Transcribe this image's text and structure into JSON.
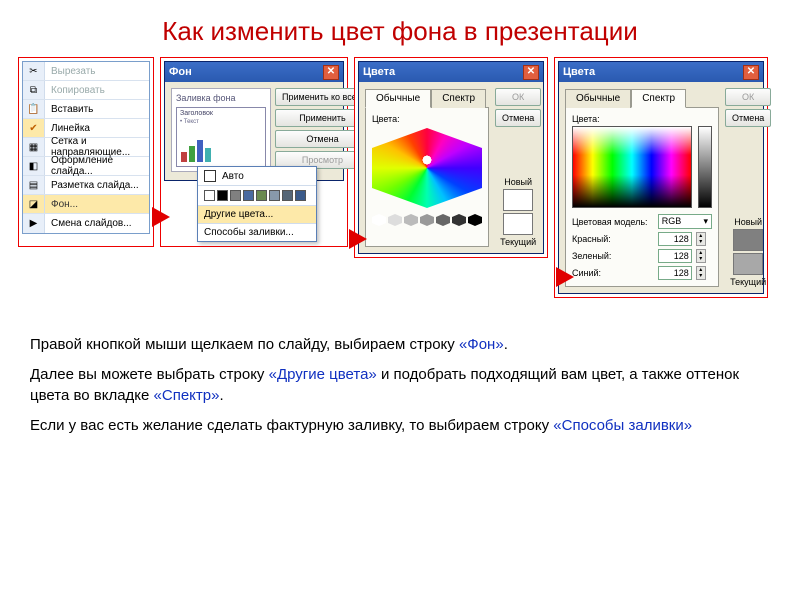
{
  "title": "Как изменить цвет фона в презентации",
  "context_menu": {
    "items": [
      {
        "label": "Вырезать",
        "dim": true,
        "icon": "cut"
      },
      {
        "label": "Копировать",
        "dim": true,
        "icon": "copy"
      },
      {
        "label": "Вставить",
        "dim": false,
        "icon": "paste"
      },
      {
        "label": "Линейка",
        "dim": false,
        "icon": "ruler",
        "checked": true
      },
      {
        "label": "Сетка и направляющие...",
        "dim": false,
        "icon": "grid"
      },
      {
        "label": "Оформление слайда...",
        "dim": false,
        "icon": "design"
      },
      {
        "label": "Разметка слайда...",
        "dim": false,
        "icon": "layout"
      },
      {
        "label": "Фон...",
        "dim": false,
        "icon": "fill",
        "selected": true
      },
      {
        "label": "Смена слайдов...",
        "dim": false,
        "icon": "transition"
      }
    ]
  },
  "bg_dialog": {
    "title": "Фон",
    "group_label": "Заливка фона",
    "thumb_title": "Заголовок",
    "thumb_body": "• Текст",
    "buttons": {
      "apply_all": "Применить ко всем",
      "apply": "Применить",
      "cancel": "Отмена",
      "preview": "Просмотр"
    },
    "palette": {
      "auto": "Авто",
      "swatches": [
        "#ffffff",
        "#000000",
        "#808080",
        "#4a6aa0",
        "#6a8a50",
        "#8899aa",
        "#556677",
        "#3a5a8a"
      ],
      "more_colors": "Другие цвета...",
      "fill_effects": "Способы заливки..."
    }
  },
  "colors_std": {
    "title": "Цвета",
    "tab_std": "Обычные",
    "tab_spec": "Спектр",
    "ok": "ОК",
    "cancel": "Отмена",
    "label_colors": "Цвета:",
    "new": "Новый",
    "current": "Текущий",
    "gray_steps": [
      "#ffffff",
      "#dddddd",
      "#bbbbbb",
      "#999999",
      "#666666",
      "#333333",
      "#000000"
    ],
    "new_color": "#ffffff",
    "current_color": "#ffffff"
  },
  "colors_spec": {
    "title": "Цвета",
    "tab_std": "Обычные",
    "tab_spec": "Спектр",
    "ok": "ОК",
    "cancel": "Отмена",
    "label_colors": "Цвета:",
    "model_label": "Цветовая модель:",
    "model_value": "RGB",
    "red_label": "Красный:",
    "green_label": "Зеленый:",
    "blue_label": "Синий:",
    "red": 128,
    "green": 128,
    "blue": 128,
    "new": "Новый",
    "current": "Текущий",
    "new_color": "#808080",
    "current_color": "#a8a8a8"
  },
  "body": {
    "p1a": "Правой кнопкой мыши щелкаем по слайду, выбираем строку ",
    "p1_kw": "«Фон»",
    "p1b": ".",
    "p2a": "Далее вы можете выбрать строку ",
    "p2_kw1": "«Другие цвета»",
    "p2b": " и подобрать подходящий вам цвет, а также оттенок цвета во вкладке ",
    "p2_kw2": "«Спектр»",
    "p2c": ".",
    "p3a": "Если у вас есть желание сделать фактурную заливку, то выбираем строку ",
    "p3_kw": "«Способы заливки»"
  }
}
